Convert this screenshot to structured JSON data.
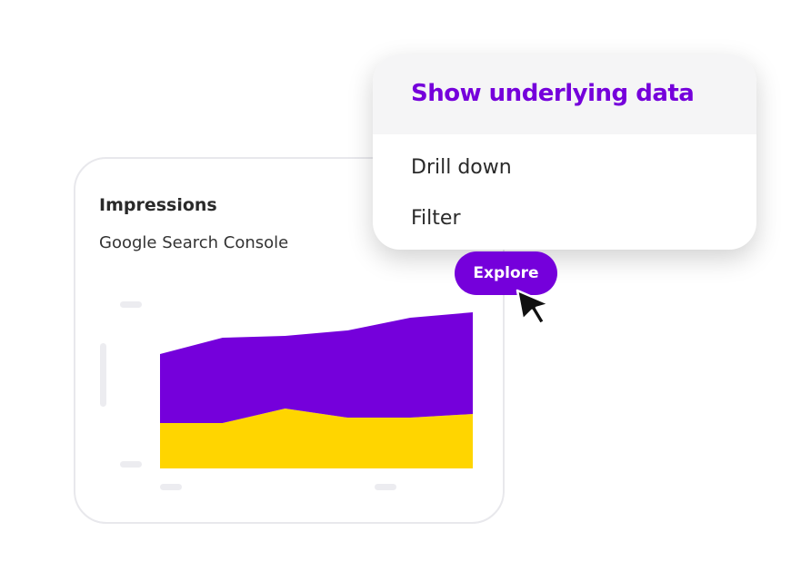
{
  "card": {
    "title": "Impressions",
    "subtitle": "Google Search Console"
  },
  "menu": {
    "header": "Show underlying data",
    "items": [
      {
        "label": "Drill down"
      },
      {
        "label": "Filter"
      }
    ]
  },
  "explore_button": {
    "label": "Explore"
  },
  "colors": {
    "accent": "#7500db",
    "secondary": "#ffd500",
    "menu_header_bg": "#f5f5f6",
    "placeholder": "#ececf0"
  },
  "icons": {
    "cursor": "arrow-cursor-icon"
  },
  "chart_data": {
    "type": "area",
    "stacked": true,
    "x": [
      1,
      2,
      3,
      4,
      5,
      6
    ],
    "ylim": [
      0,
      100
    ],
    "series": [
      {
        "color": "#ffd500",
        "values": [
          25,
          25,
          33,
          28,
          28,
          30
        ]
      },
      {
        "color": "#7500db",
        "values": [
          38,
          47,
          40,
          48,
          55,
          56
        ]
      }
    ]
  }
}
